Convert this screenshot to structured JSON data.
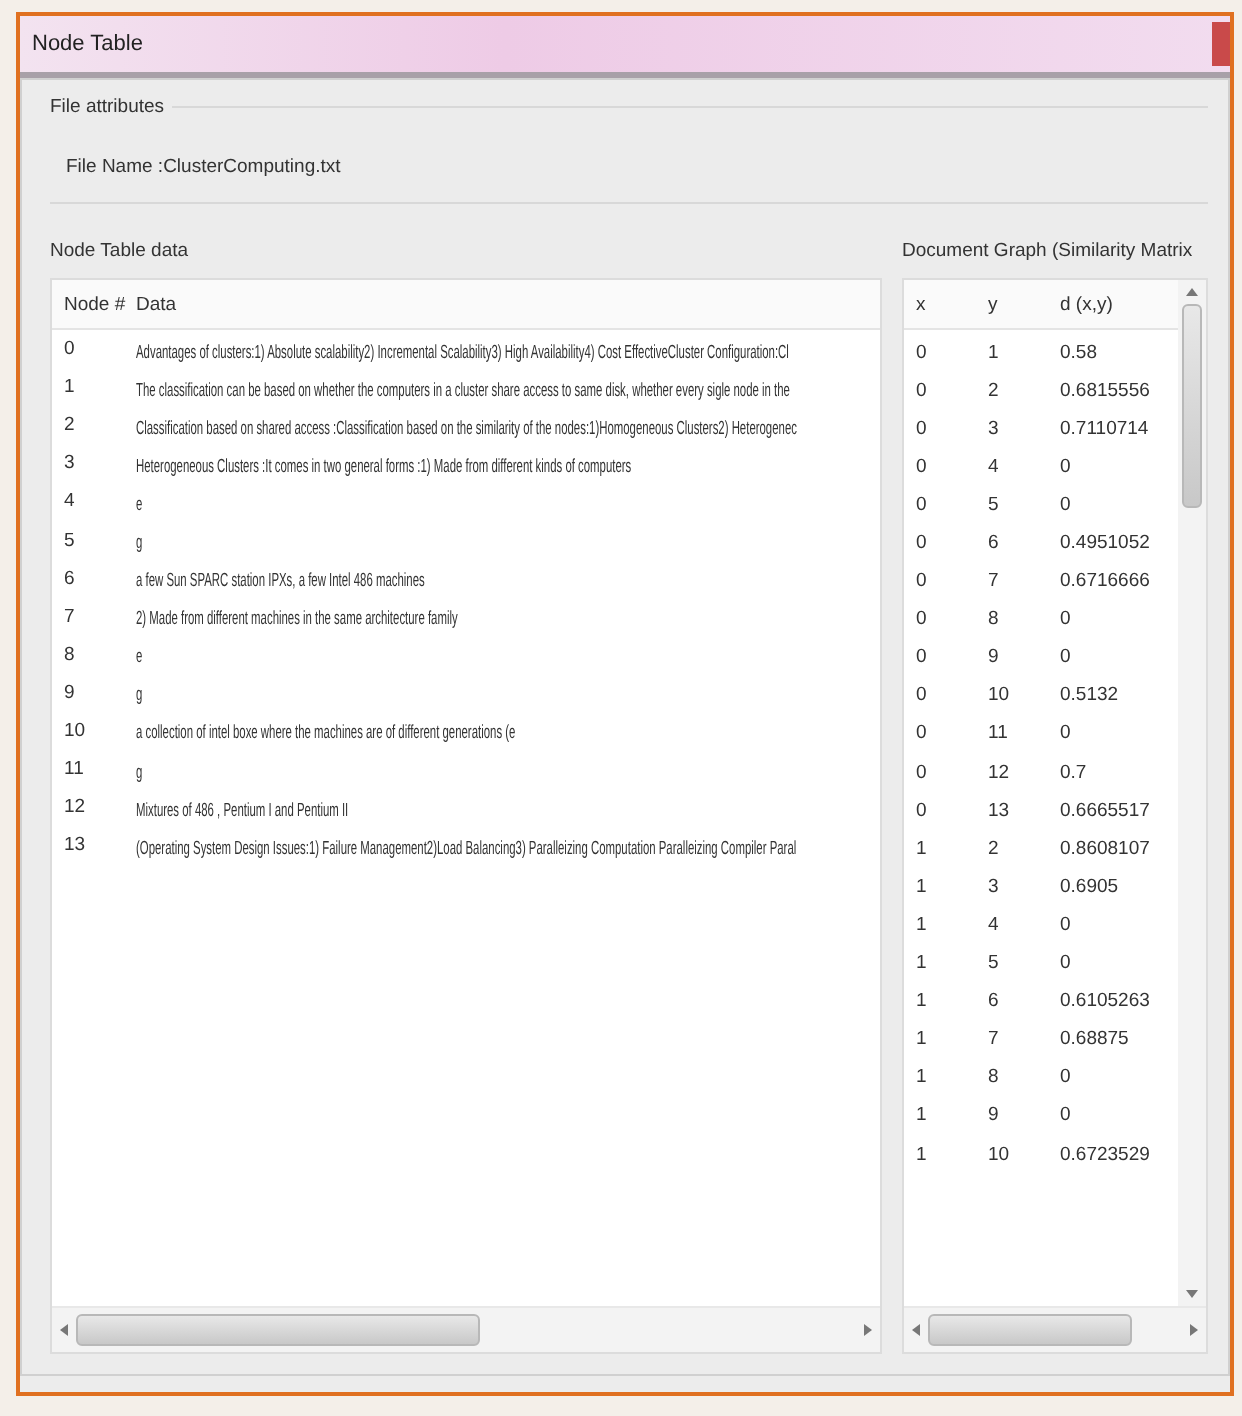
{
  "window": {
    "title": "Node Table"
  },
  "file_attributes": {
    "heading": "File attributes",
    "file_name": "File Name :ClusterComputing.txt"
  },
  "node_table": {
    "heading": "Node Table data",
    "columns": [
      "Node #",
      "Data"
    ],
    "rows": [
      [
        "0",
        "Advantages of clusters:1) Absolute scalability2) Incremental Scalability3) High Availability4) Cost EffectiveCluster Configuration:Cl"
      ],
      [
        "1",
        "The classification can be based on whether the computers in a cluster share access to same disk, whether every sigle node in the"
      ],
      [
        "2",
        "Classification based on shared access :Classification based on the similarity of the nodes:1)Homogeneous Clusters2) Heterogenec"
      ],
      [
        "3",
        "Heterogeneous Clusters :It comes in two general forms :1) Made from different kinds of computers"
      ],
      [
        "4",
        "e"
      ],
      [
        "5",
        "g"
      ],
      [
        "6",
        "a few Sun SPARC station IPXs, a few Intel 486 machines"
      ],
      [
        "7",
        "2) Made from different machines in the same architecture family"
      ],
      [
        "8",
        "e"
      ],
      [
        "9",
        "g"
      ],
      [
        "10",
        "a collection of intel boxe where the machines are of different generations (e"
      ],
      [
        "11",
        "g"
      ],
      [
        "12",
        "Mixtures of 486 , Pentium I and Pentium II"
      ],
      [
        "13",
        "(Operating System Design Issues:1) Failure Management2)Load Balancing3) Paralleizing Computation Paralleizing Compiler Paral"
      ]
    ]
  },
  "similarity_table": {
    "heading": "Document Graph (Similarity Matrix",
    "columns": [
      "x",
      "y",
      "d (x,y)"
    ],
    "rows": [
      [
        "0",
        "1",
        "0.58"
      ],
      [
        "0",
        "2",
        "0.6815556"
      ],
      [
        "0",
        "3",
        "0.7110714"
      ],
      [
        "0",
        "4",
        "0"
      ],
      [
        "0",
        "5",
        "0"
      ],
      [
        "0",
        "6",
        "0.4951052"
      ],
      [
        "0",
        "7",
        "0.6716666"
      ],
      [
        "0",
        "8",
        "0"
      ],
      [
        "0",
        "9",
        "0"
      ],
      [
        "0",
        "10",
        "0.5132"
      ],
      [
        "0",
        "11",
        "0"
      ],
      [
        "0",
        "12",
        "0.7"
      ],
      [
        "0",
        "13",
        "0.6665517"
      ],
      [
        "1",
        "2",
        "0.8608107"
      ],
      [
        "1",
        "3",
        "0.6905"
      ],
      [
        "1",
        "4",
        "0"
      ],
      [
        "1",
        "5",
        "0"
      ],
      [
        "1",
        "6",
        "0.6105263"
      ],
      [
        "1",
        "7",
        "0.68875"
      ],
      [
        "1",
        "8",
        "0"
      ],
      [
        "1",
        "9",
        "0"
      ],
      [
        "1",
        "10",
        "0.6723529"
      ]
    ]
  }
}
